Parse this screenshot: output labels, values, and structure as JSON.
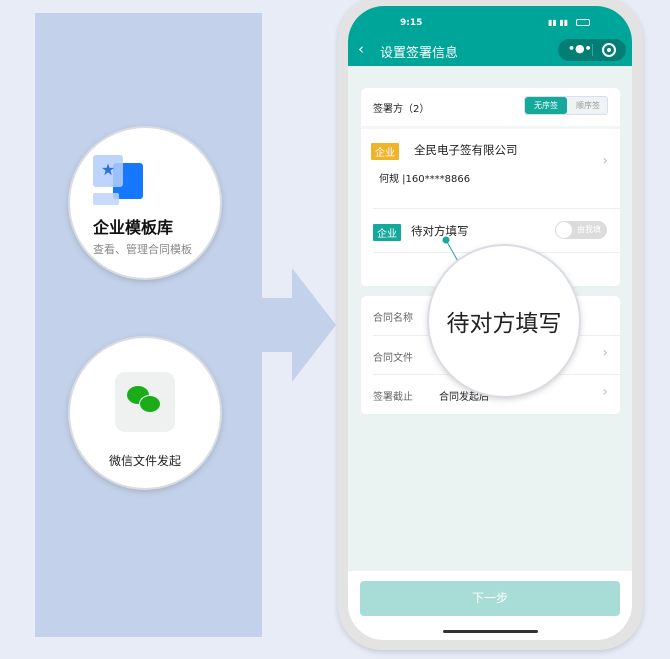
{
  "left": {
    "template_title": "企业模板库",
    "template_sub": "查看、管理合同模板",
    "wechat_label": "微信文件发起"
  },
  "phone": {
    "status_time": "9:15",
    "title": "设置签署信息",
    "signers_label": "签署方（2）",
    "mode_options": [
      "无序签",
      "顺序签"
    ],
    "mode_selected": "无序签",
    "signer1": {
      "tag": "企业",
      "name": "全民电子签有限公司",
      "contact": "何规 |160****8866",
      "tag_color": "#f0b429"
    },
    "signer2": {
      "tag": "企业",
      "name": "待对方填写",
      "toggle_label": "由我填",
      "toggle_on": false,
      "tag_color": "#14a99a"
    },
    "fields": [
      {
        "label": "合同名称",
        "value": ""
      },
      {
        "label": "合同文件",
        "value": ""
      },
      {
        "label": "签署截止",
        "value": "合同发起后"
      }
    ],
    "magnifier_text": "待对方填写",
    "next_button": "下一步",
    "accent": "#00a59a"
  }
}
